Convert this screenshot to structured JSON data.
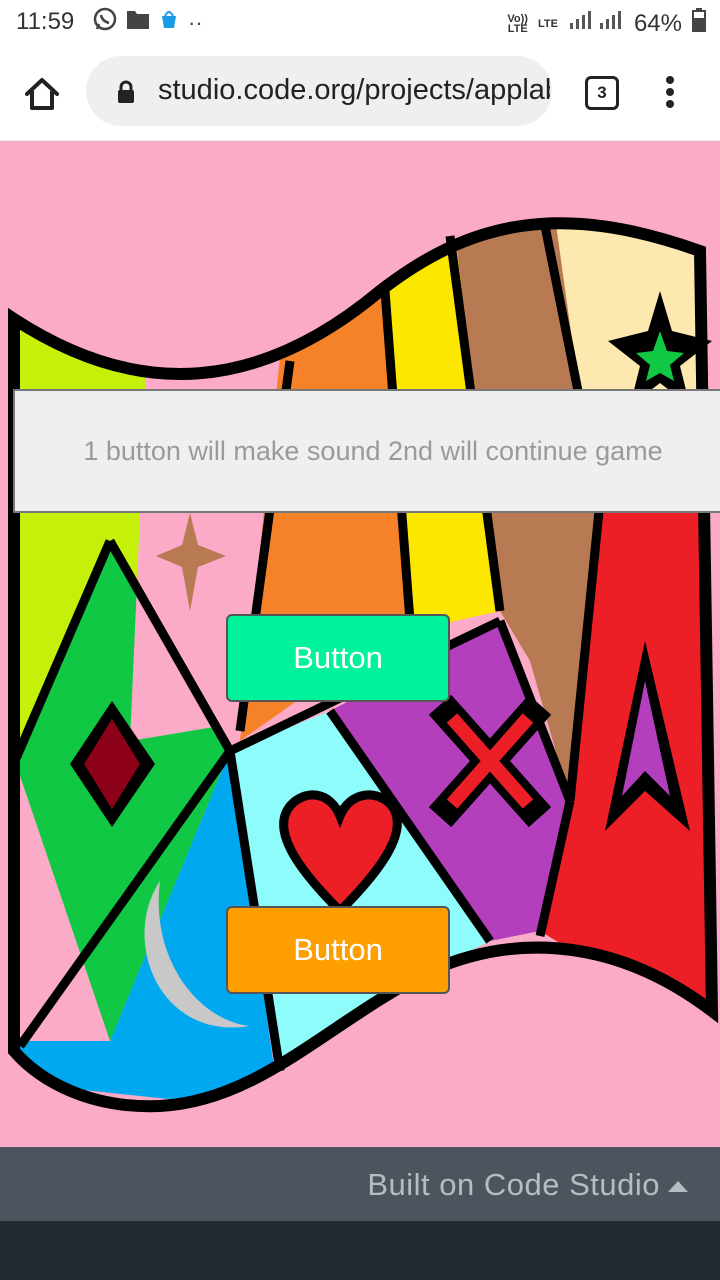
{
  "status_bar": {
    "time": "11:59",
    "left_icons": [
      "whatsapp-icon",
      "folder-icon",
      "shopping-bag-icon",
      "more-dots-icon"
    ],
    "volte_label": "Vo))\nLTE",
    "lte_label": "LTE",
    "battery_percent": "64%"
  },
  "browser": {
    "url": "studio.code.org/projects/applab",
    "tab_count": "3"
  },
  "app": {
    "text_input_value": "1 button will make  sound 2nd will continue game",
    "button1_label": "Button",
    "button2_label": "Button",
    "colors": {
      "background": "#fbabc8",
      "button1": "#00f29b",
      "button2": "#ff9e00"
    }
  },
  "footer": {
    "label": "Built on Code Studio"
  }
}
